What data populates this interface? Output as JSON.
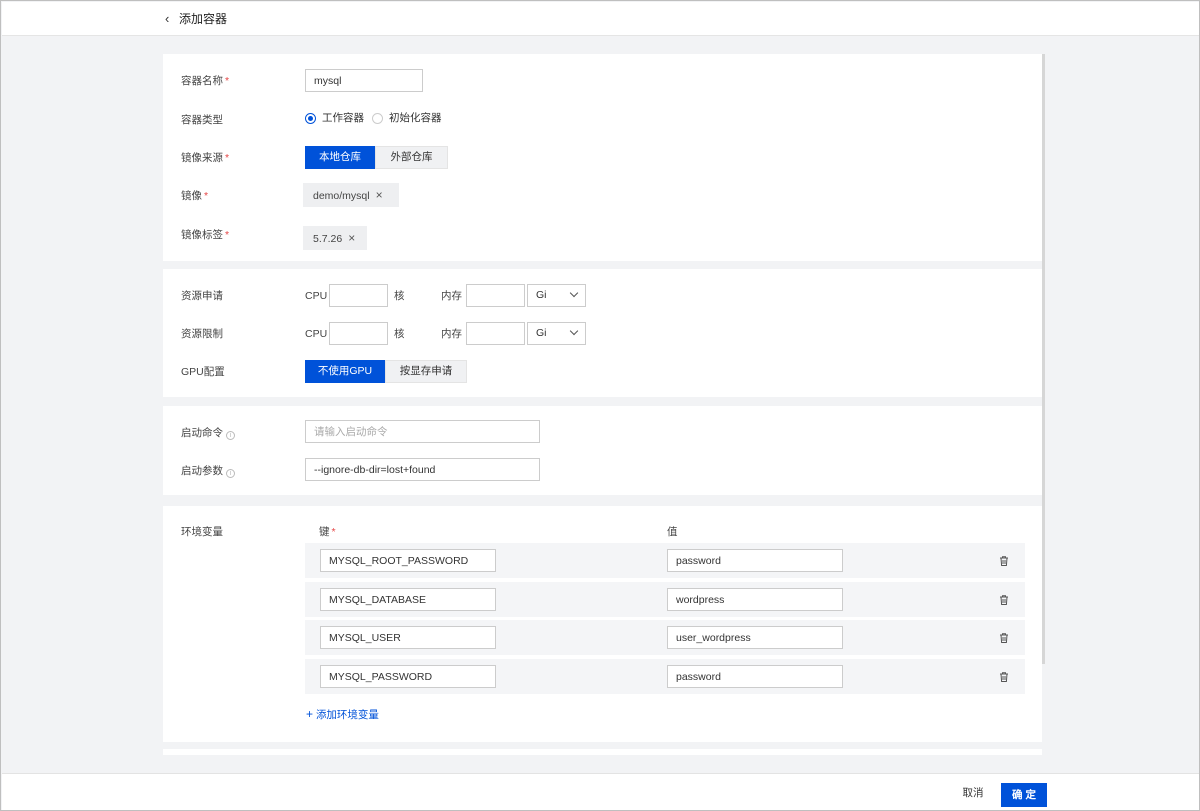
{
  "header": {
    "title": "添加容器"
  },
  "basic": {
    "name_label": "容器名称",
    "name_value": "mysql",
    "type_label": "容器类型",
    "type_options": [
      "工作容器",
      "初始化容器"
    ],
    "type_selected": "工作容器",
    "source_label": "镜像来源",
    "source_options": [
      "本地仓库",
      "外部仓库"
    ],
    "source_selected": "本地仓库",
    "image_label": "镜像",
    "image_value": "demo/mysql",
    "tag_label": "镜像标签",
    "tag_value": "5.7.26",
    "required_mark": "*"
  },
  "resources": {
    "request_label": "资源申请",
    "limit_label": "资源限制",
    "cpu_label": "CPU",
    "cpu_unit": "核",
    "memory_label": "内存",
    "memory_unit": "Gi",
    "gpu_label": "GPU配置",
    "gpu_options": [
      "不使用GPU",
      "按显存申请"
    ],
    "gpu_selected": "不使用GPU"
  },
  "command": {
    "cmd_label": "启动命令",
    "cmd_placeholder": "请输入启动命令",
    "args_label": "启动参数",
    "args_value": "--ignore-db-dir=lost+found"
  },
  "env": {
    "label": "环境变量",
    "key_header": "键",
    "value_header": "值",
    "rows": [
      {
        "key": "MYSQL_ROOT_PASSWORD",
        "value": "password"
      },
      {
        "key": "MYSQL_DATABASE",
        "value": "wordpress"
      },
      {
        "key": "MYSQL_USER",
        "value": "user_wordpress"
      },
      {
        "key": "MYSQL_PASSWORD",
        "value": "password"
      }
    ],
    "add_label": "添加环境变量"
  },
  "footer": {
    "cancel_label": "取消",
    "confirm_label": "确 定"
  },
  "colors": {
    "primary": "#0052d9",
    "required": "#e54545",
    "background": "#f2f3f5"
  },
  "icons": {
    "back": "chevron-left-icon",
    "close": "close-icon",
    "info": "info-icon",
    "delete": "trash-icon",
    "add": "plus-icon",
    "dropdown": "chevron-down-icon"
  }
}
